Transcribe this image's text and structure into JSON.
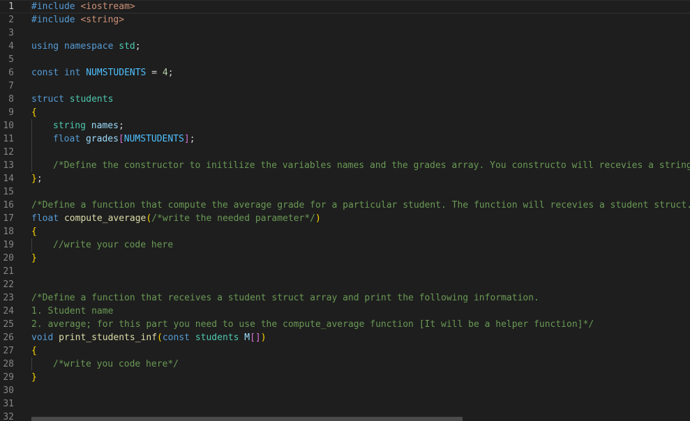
{
  "editor": {
    "theme_colors": {
      "background": "#1e1e1e",
      "comment": "#6a9955",
      "keyword": "#569cd6",
      "string": "#ce9178",
      "type": "#4ec9b0",
      "function": "#dcdcaa",
      "variable": "#9cdcfe",
      "number": "#b5cea8",
      "brace": "#ffd700",
      "bracket": "#da70d6",
      "constant": "#4fc1ff"
    },
    "line_numbers": [
      "1",
      "2",
      "3",
      "4",
      "5",
      "6",
      "7",
      "8",
      "9",
      "10",
      "11",
      "12",
      "13",
      "14",
      "15",
      "16",
      "17",
      "18",
      "19",
      "20",
      "21",
      "22",
      "23",
      "24",
      "25",
      "26",
      "27",
      "28",
      "29",
      "30",
      "31",
      "32"
    ],
    "lines": [
      [
        {
          "t": "#include ",
          "c": "keyword"
        },
        {
          "t": "<iostream>",
          "c": "string"
        }
      ],
      [
        {
          "t": "#include ",
          "c": "keyword"
        },
        {
          "t": "<string>",
          "c": "string"
        }
      ],
      [],
      [
        {
          "t": "using",
          "c": "keyword"
        },
        {
          "t": " ",
          "c": "plain"
        },
        {
          "t": "namespace",
          "c": "keyword"
        },
        {
          "t": " ",
          "c": "plain"
        },
        {
          "t": "std",
          "c": "type"
        },
        {
          "t": ";",
          "c": "plain"
        }
      ],
      [],
      [
        {
          "t": "const",
          "c": "keyword"
        },
        {
          "t": " ",
          "c": "plain"
        },
        {
          "t": "int",
          "c": "keyword"
        },
        {
          "t": " ",
          "c": "plain"
        },
        {
          "t": "NUMSTUDENTS",
          "c": "constant"
        },
        {
          "t": " = ",
          "c": "plain"
        },
        {
          "t": "4",
          "c": "number"
        },
        {
          "t": ";",
          "c": "plain"
        }
      ],
      [],
      [
        {
          "t": "struct",
          "c": "keyword"
        },
        {
          "t": " ",
          "c": "plain"
        },
        {
          "t": "students",
          "c": "type"
        }
      ],
      [
        {
          "t": "{",
          "c": "brace"
        }
      ],
      [
        {
          "indent": 1
        },
        {
          "t": "string",
          "c": "type"
        },
        {
          "t": " ",
          "c": "plain"
        },
        {
          "t": "names",
          "c": "variable"
        },
        {
          "t": ";",
          "c": "plain"
        }
      ],
      [
        {
          "indent": 1
        },
        {
          "t": "float",
          "c": "keyword"
        },
        {
          "t": " ",
          "c": "plain"
        },
        {
          "t": "grades",
          "c": "variable"
        },
        {
          "t": "[",
          "c": "bracket"
        },
        {
          "t": "NUMSTUDENTS",
          "c": "constant"
        },
        {
          "t": "]",
          "c": "bracket"
        },
        {
          "t": ";",
          "c": "plain"
        }
      ],
      [
        {
          "indent": 1
        }
      ],
      [
        {
          "indent": 1
        },
        {
          "t": "/*Define the constructor to initilize the variables names and the grades array. You constructo will recevies a string v",
          "c": "comment"
        }
      ],
      [
        {
          "t": "}",
          "c": "brace"
        },
        {
          "t": ";",
          "c": "plain"
        }
      ],
      [],
      [
        {
          "t": "/*Define a function that compute the average grade for a particular student. The function will recevies a student struct. t",
          "c": "comment"
        }
      ],
      [
        {
          "t": "float",
          "c": "keyword"
        },
        {
          "t": " ",
          "c": "plain"
        },
        {
          "t": "compute_average",
          "c": "function"
        },
        {
          "t": "(",
          "c": "brace"
        },
        {
          "t": "/*write the needed parameter*/",
          "c": "comment"
        },
        {
          "t": ")",
          "c": "brace"
        }
      ],
      [
        {
          "t": "{",
          "c": "brace"
        }
      ],
      [
        {
          "indent": 1
        },
        {
          "t": "//write your code here",
          "c": "comment"
        }
      ],
      [
        {
          "t": "}",
          "c": "brace"
        }
      ],
      [],
      [],
      [
        {
          "t": "/*Define a function that receives a student struct array and print the following information.",
          "c": "comment"
        }
      ],
      [
        {
          "t": "1. Student name",
          "c": "comment"
        }
      ],
      [
        {
          "t": "2. average; for this part you need to use the compute_average function [It will be a helper function]*/",
          "c": "comment"
        }
      ],
      [
        {
          "t": "void",
          "c": "keyword"
        },
        {
          "t": " ",
          "c": "plain"
        },
        {
          "t": "print_students_inf",
          "c": "function"
        },
        {
          "t": "(",
          "c": "brace"
        },
        {
          "t": "const",
          "c": "keyword"
        },
        {
          "t": " ",
          "c": "plain"
        },
        {
          "t": "students",
          "c": "type"
        },
        {
          "t": " ",
          "c": "plain"
        },
        {
          "t": "M",
          "c": "variable"
        },
        {
          "t": "[]",
          "c": "bracket"
        },
        {
          "t": ")",
          "c": "brace"
        }
      ],
      [
        {
          "t": "{",
          "c": "brace"
        }
      ],
      [
        {
          "indent": 1
        },
        {
          "t": "/*write you code here*/",
          "c": "comment"
        }
      ],
      [
        {
          "t": "}",
          "c": "brace"
        }
      ],
      [],
      [],
      []
    ]
  }
}
